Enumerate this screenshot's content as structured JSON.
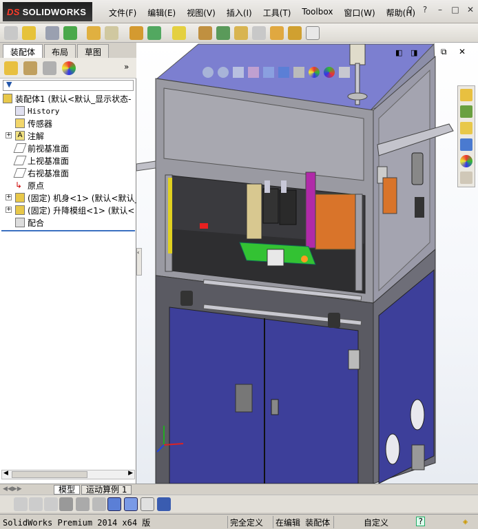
{
  "app": {
    "logo_text": "SOLIDWORKS",
    "logo_prefix": "DS"
  },
  "menu": [
    "文件(F)",
    "编辑(E)",
    "视图(V)",
    "插入(I)",
    "工具(T)",
    "Toolbox",
    "窗口(W)",
    "帮助(H)"
  ],
  "window_controls": {
    "search": "search-icon",
    "help": "?",
    "minimize": "–",
    "restore": "□",
    "close": "✕"
  },
  "panel_tabs": [
    "装配体",
    "布局",
    "草图"
  ],
  "tree": {
    "root": "装配体1  (默认<默认_显示状态-",
    "items": [
      "History",
      "传感器",
      "注解",
      "前视基准面",
      "上视基准面",
      "右视基准面",
      "原点",
      "(固定) 机身<1> (默认<默认_",
      "(固定) 升降模组<1> (默认<",
      "配合"
    ]
  },
  "bottom_tabs": [
    "模型",
    "运动算例 1"
  ],
  "status": {
    "product": "SolidWorks Premium 2014 x64 版",
    "definition": "完全定义",
    "editing": "在编辑 装配体",
    "units": "自定义",
    "help": "?"
  },
  "colors": {
    "cabinet_blue": "#3d3f9a",
    "frame_gray": "#9a9aa2",
    "panel_top": "#7c7fd0",
    "accent_green": "#33c233",
    "accent_orange": "#d9742a",
    "accent_purple": "#b02aa8"
  }
}
